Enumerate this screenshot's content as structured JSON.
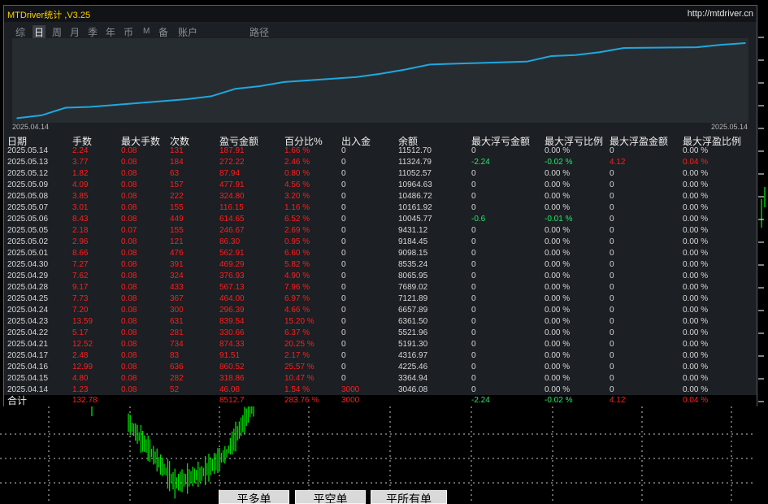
{
  "window": {
    "title": "MTDriver统计 ,V3.25",
    "url": "http://mtdriver.cn"
  },
  "tabs": [
    {
      "label": "综",
      "active": false
    },
    {
      "label": "日",
      "active": true
    },
    {
      "label": "周",
      "active": false
    },
    {
      "label": "月",
      "active": false
    },
    {
      "label": "季",
      "active": false
    },
    {
      "label": "年",
      "active": false
    },
    {
      "label": "币",
      "active": false
    },
    {
      "label": "M",
      "active": false
    },
    {
      "label": "备",
      "active": false
    },
    {
      "label": "账户",
      "active": false
    },
    {
      "label": "路径",
      "active": false
    }
  ],
  "chart_data": {
    "type": "line",
    "x_start": "2025.04.14",
    "x_end": "2025.05.14",
    "x": [
      "2025.04.14",
      "2025.04.15",
      "2025.04.16",
      "2025.04.17",
      "2025.04.21",
      "2025.04.22",
      "2025.04.23",
      "2025.04.24",
      "2025.04.25",
      "2025.04.28",
      "2025.04.29",
      "2025.04.30",
      "2025.05.01",
      "2025.05.02",
      "2025.05.05",
      "2025.05.06",
      "2025.05.07",
      "2025.05.08",
      "2025.05.09",
      "2025.05.12",
      "2025.05.13",
      "2025.05.14"
    ],
    "values": [
      3046.08,
      3364.94,
      4225.46,
      4316.97,
      5191.3,
      5521.96,
      6361.5,
      6657.89,
      7121.89,
      7689.02,
      8065.95,
      8535.24,
      9098.15,
      9184.45,
      9431.12,
      10045.77,
      10161.92,
      10486.72,
      10964.63,
      11052.57,
      11324.79,
      11512.7
    ],
    "ylim": [
      2900,
      11700
    ],
    "color": "#1ea8e0",
    "grid": false
  },
  "table": {
    "headers": [
      "日期",
      "手数",
      "最大手数",
      "次数",
      "盈亏金额",
      "百分比%",
      "出入金",
      "余额",
      "最大浮亏金额",
      "最大浮亏比例",
      "最大浮盈金额",
      "最大浮盈比例"
    ],
    "rows": [
      [
        "2025.05.14",
        "2.24",
        "0.08",
        "131",
        "187.91",
        "1.66 %",
        "0",
        "11512.70",
        "0",
        "0.00 %",
        "0",
        "0.00 %"
      ],
      [
        "2025.05.13",
        "3.77",
        "0.08",
        "184",
        "272.22",
        "2.46 %",
        "0",
        "11324.79",
        "-2.24",
        "-0.02 %",
        "4.12",
        "0.04 %"
      ],
      [
        "2025.05.12",
        "1.82",
        "0.08",
        "63",
        "87.94",
        "0.80 %",
        "0",
        "11052.57",
        "0",
        "0.00 %",
        "0",
        "0.00 %"
      ],
      [
        "2025.05.09",
        "4.09",
        "0.08",
        "157",
        "477.91",
        "4.56 %",
        "0",
        "10964.63",
        "0",
        "0.00 %",
        "0",
        "0.00 %"
      ],
      [
        "2025.05.08",
        "3.85",
        "0.08",
        "222",
        "324.80",
        "3.20 %",
        "0",
        "10486.72",
        "0",
        "0.00 %",
        "0",
        "0.00 %"
      ],
      [
        "2025.05.07",
        "3.01",
        "0.08",
        "155",
        "116.15",
        "1.16 %",
        "0",
        "10161.92",
        "0",
        "0.00 %",
        "0",
        "0.00 %"
      ],
      [
        "2025.05.06",
        "8.43",
        "0.08",
        "449",
        "614.65",
        "6.52 %",
        "0",
        "10045.77",
        "-0.6",
        "-0.01 %",
        "0",
        "0.00 %"
      ],
      [
        "2025.05.05",
        "2.18",
        "0.07",
        "155",
        "246.67",
        "2.69 %",
        "0",
        "9431.12",
        "0",
        "0.00 %",
        "0",
        "0.00 %"
      ],
      [
        "2025.05.02",
        "2.96",
        "0.08",
        "121",
        "86.30",
        "0.95 %",
        "0",
        "9184.45",
        "0",
        "0.00 %",
        "0",
        "0.00 %"
      ],
      [
        "2025.05.01",
        "8.66",
        "0.08",
        "476",
        "562.91",
        "6.60 %",
        "0",
        "9098.15",
        "0",
        "0.00 %",
        "0",
        "0.00 %"
      ],
      [
        "2025.04.30",
        "7.27",
        "0.08",
        "391",
        "469.29",
        "5.82 %",
        "0",
        "8535.24",
        "0",
        "0.00 %",
        "0",
        "0.00 %"
      ],
      [
        "2025.04.29",
        "7.62",
        "0.08",
        "324",
        "376.93",
        "4.90 %",
        "0",
        "8065.95",
        "0",
        "0.00 %",
        "0",
        "0.00 %"
      ],
      [
        "2025.04.28",
        "9.17",
        "0.08",
        "433",
        "567.13",
        "7.96 %",
        "0",
        "7689.02",
        "0",
        "0.00 %",
        "0",
        "0.00 %"
      ],
      [
        "2025.04.25",
        "7.73",
        "0.08",
        "367",
        "464.00",
        "6.97 %",
        "0",
        "7121.89",
        "0",
        "0.00 %",
        "0",
        "0.00 %"
      ],
      [
        "2025.04.24",
        "7.20",
        "0.08",
        "300",
        "296.39",
        "4.66 %",
        "0",
        "6657.89",
        "0",
        "0.00 %",
        "0",
        "0.00 %"
      ],
      [
        "2025.04.23",
        "13.59",
        "0.08",
        "631",
        "839.54",
        "15.20 %",
        "0",
        "6361.50",
        "0",
        "0.00 %",
        "0",
        "0.00 %"
      ],
      [
        "2025.04.22",
        "5.17",
        "0.08",
        "281",
        "330.66",
        "6.37 %",
        "0",
        "5521.96",
        "0",
        "0.00 %",
        "0",
        "0.00 %"
      ],
      [
        "2025.04.21",
        "12.52",
        "0.08",
        "734",
        "874.33",
        "20.25 %",
        "0",
        "5191.30",
        "0",
        "0.00 %",
        "0",
        "0.00 %"
      ],
      [
        "2025.04.17",
        "2.48",
        "0.08",
        "83",
        "91.51",
        "2.17 %",
        "0",
        "4316.97",
        "0",
        "0.00 %",
        "0",
        "0.00 %"
      ],
      [
        "2025.04.16",
        "12.99",
        "0.08",
        "636",
        "860.52",
        "25.57 %",
        "0",
        "4225.46",
        "0",
        "0.00 %",
        "0",
        "0.00 %"
      ],
      [
        "2025.04.15",
        "4.80",
        "0.08",
        "282",
        "318.86",
        "10.47 %",
        "0",
        "3364.94",
        "0",
        "0.00 %",
        "0",
        "0.00 %"
      ],
      [
        "2025.04.14",
        "1.23",
        "0.08",
        "52",
        "46.08",
        "1.54 %",
        "3000",
        "3046.08",
        "0",
        "0.00 %",
        "0",
        "0.00 %"
      ]
    ],
    "total": {
      "label": "合计",
      "lots": "132.78",
      "pnl": "8512.7",
      "percent": "283.76 %",
      "deposit": "3000",
      "max_float_loss": "-2.24",
      "max_float_loss_pct": "-0.02 %",
      "max_float_profit": "4.12",
      "max_float_profit_pct": "0.04 %"
    }
  },
  "buttons": [
    {
      "label": "平多单"
    },
    {
      "label": "平空单"
    },
    {
      "label": "平所有单"
    }
  ],
  "colors": {
    "profit_text": "#ff1e1e",
    "loss_text": "#22e86a",
    "neutral_text": "#d8d8d8",
    "title_text": "#ffd000",
    "candle": "#00e000",
    "grid": "#c8c8c8"
  }
}
